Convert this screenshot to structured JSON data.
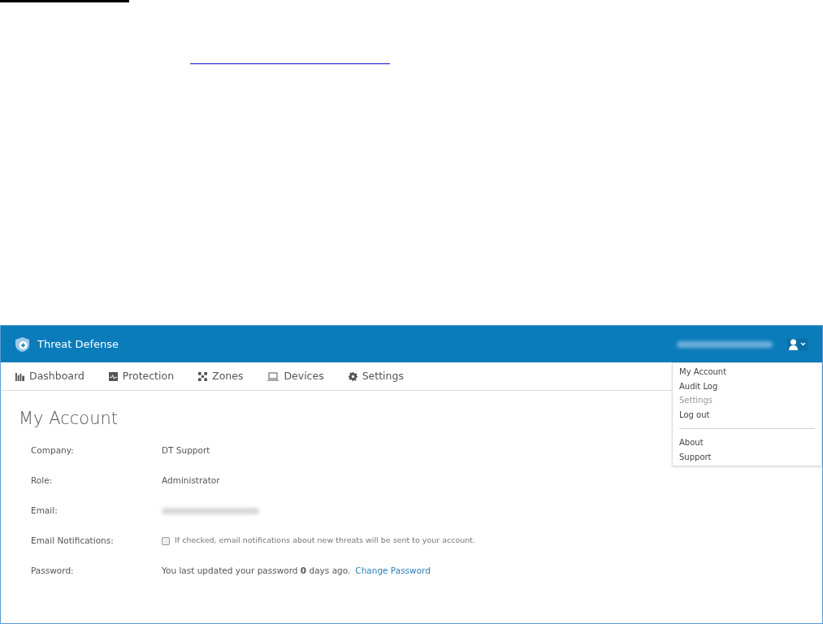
{
  "app": {
    "title": "Threat Defense"
  },
  "nav": [
    {
      "label": "Dashboard",
      "kind": "chart"
    },
    {
      "label": "Protection",
      "kind": "pulse"
    },
    {
      "label": "Zones",
      "kind": "nodes"
    },
    {
      "label": "Devices",
      "kind": "laptop"
    },
    {
      "label": "Settings",
      "kind": "gear"
    }
  ],
  "user_menu": {
    "expanded": true,
    "groups": [
      [
        {
          "label": "My Account",
          "disabled": false
        },
        {
          "label": "Audit Log",
          "disabled": false
        },
        {
          "label": "Settings",
          "disabled": true
        },
        {
          "label": "Log out",
          "disabled": false
        }
      ],
      [
        {
          "label": "About",
          "disabled": false
        },
        {
          "label": "Support",
          "disabled": false
        }
      ]
    ]
  },
  "page_title": "My Account",
  "fields": [
    {
      "label": "Company:",
      "kind": "text",
      "value": "DT Support"
    },
    {
      "label": "Role:",
      "kind": "text",
      "value": "Administrator"
    },
    {
      "label": "Email:",
      "kind": "redacted"
    },
    {
      "label": "Email Notifications:",
      "kind": "checkbox",
      "checked": false,
      "value": "If checked, email notifications about new threats will be sent to your account."
    },
    {
      "label": "Password:",
      "kind": "password",
      "value": "You last updated your password **0** days ago.",
      "link": "Change Password"
    }
  ]
}
